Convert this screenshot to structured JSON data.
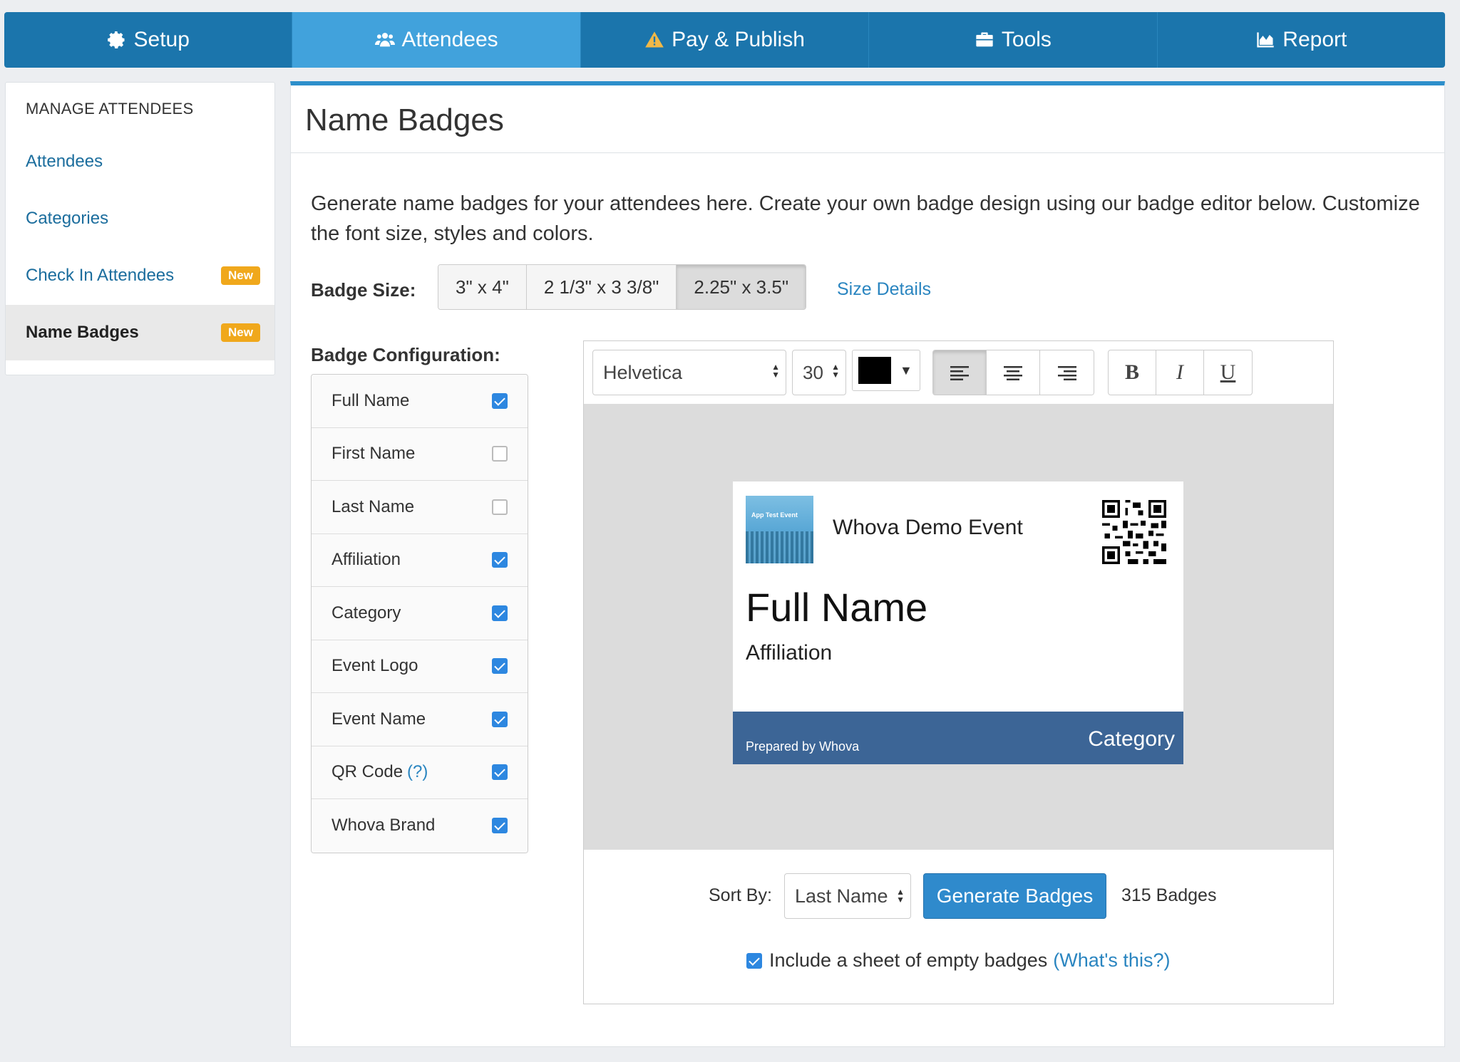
{
  "nav": {
    "tabs": [
      {
        "label": "Setup",
        "icon": "gear-icon"
      },
      {
        "label": "Attendees",
        "icon": "users-icon"
      },
      {
        "label": "Pay & Publish",
        "icon": "warning-icon"
      },
      {
        "label": "Tools",
        "icon": "briefcase-icon"
      },
      {
        "label": "Report",
        "icon": "area-chart-icon"
      }
    ],
    "active": "Attendees"
  },
  "sidebar": {
    "heading": "MANAGE ATTENDEES",
    "items": [
      {
        "label": "Attendees"
      },
      {
        "label": "Categories"
      },
      {
        "label": "Check In Attendees",
        "badge": "New"
      },
      {
        "label": "Name Badges",
        "badge": "New",
        "active": true
      }
    ]
  },
  "main": {
    "title": "Name Badges",
    "description": "Generate name badges for your attendees here. Create your own badge design using our badge editor below. Customize the font size, styles and colors.",
    "badge_size_label": "Badge Size:",
    "badge_sizes": [
      "3\" x 4\"",
      "2 1/3\" x 3 3/8\"",
      "2.25\" x 3.5\""
    ],
    "selected_size": "2.25\" x 3.5\"",
    "size_details_link": "Size Details",
    "config_label": "Badge Configuration:",
    "config_items": [
      {
        "label": "Full Name",
        "checked": true
      },
      {
        "label": "First Name",
        "checked": false
      },
      {
        "label": "Last Name",
        "checked": false
      },
      {
        "label": "Affiliation",
        "checked": true
      },
      {
        "label": "Category",
        "checked": true
      },
      {
        "label": "Event Logo",
        "checked": true
      },
      {
        "label": "Event Name",
        "checked": true
      },
      {
        "label": "QR Code",
        "help": "(?)",
        "checked": true
      },
      {
        "label": "Whova Brand",
        "checked": true
      }
    ]
  },
  "editor": {
    "font": "Helvetica",
    "font_size": "30",
    "color": "#000000",
    "alignment": "left",
    "style_buttons": [
      "B",
      "I",
      "U"
    ]
  },
  "badge_preview": {
    "logo_text": "App Test Event",
    "event_name": "Whova Demo Event",
    "full_name": "Full Name",
    "affiliation": "Affiliation",
    "prepared_by": "Prepared by Whova",
    "category": "Category"
  },
  "actions": {
    "sort_label": "Sort By:",
    "sort_value": "Last Name",
    "generate_label": "Generate Badges",
    "badge_count": "315 Badges",
    "empty_sheet_label": "Include a sheet of empty badges",
    "empty_sheet_checked": true,
    "whats_this": "(What's this?)"
  }
}
